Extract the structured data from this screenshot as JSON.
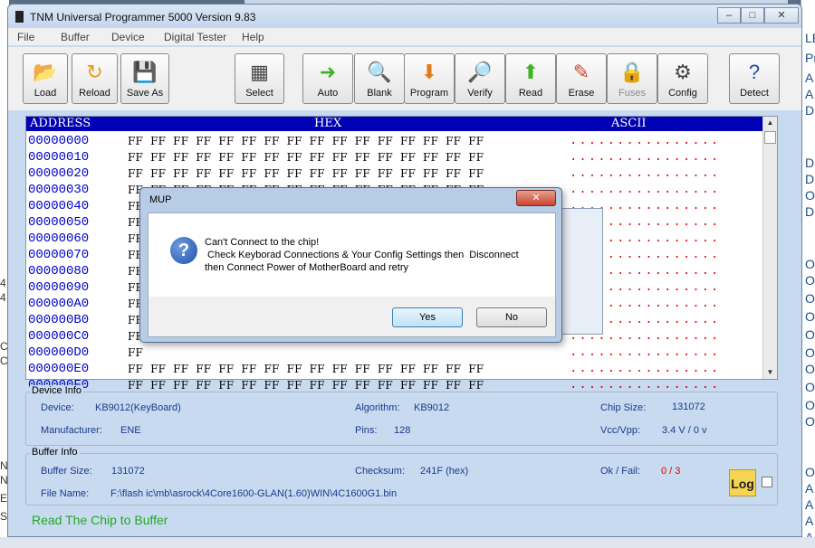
{
  "app": {
    "title": "TNM  Universal Programmer 5000  Version 9.83",
    "window_controls": [
      "–",
      "□",
      "✕"
    ]
  },
  "menu": [
    "File",
    "Buffer",
    "Device",
    "Digital Tester",
    "Help"
  ],
  "toolbar": [
    {
      "label": "Load",
      "icon": "folder-open-icon",
      "color": "#6abf3a",
      "glyph": "📂"
    },
    {
      "label": "Reload",
      "icon": "reload-folder-icon",
      "color": "#e89a1c",
      "glyph": "↻"
    },
    {
      "label": "Save As",
      "icon": "floppy-disk-icon",
      "color": "#333333",
      "glyph": "💾"
    },
    {
      "label": "Select",
      "icon": "chip-icon",
      "color": "#444444",
      "glyph": "▦"
    },
    {
      "label": "Auto",
      "icon": "green-arrow-icon",
      "color": "#3fb32a",
      "glyph": "➜"
    },
    {
      "label": "Blank",
      "icon": "magnifier-icon",
      "color": "#555555",
      "glyph": "🔍"
    },
    {
      "label": "Program",
      "icon": "download-arrow-icon",
      "color": "#e07a1a",
      "glyph": "⬇"
    },
    {
      "label": "Verify",
      "icon": "verify-magnifier-icon",
      "color": "#444444",
      "glyph": "🔎"
    },
    {
      "label": "Read",
      "icon": "read-arrow-icon",
      "color": "#3fb32a",
      "glyph": "⬆"
    },
    {
      "label": "Erase",
      "icon": "eraser-icon",
      "color": "#d2452e",
      "glyph": "✎"
    },
    {
      "label": "Fuses",
      "icon": "lock-icon",
      "color": "#d9b84a",
      "glyph": "🔒",
      "disabled": true
    },
    {
      "label": "Config",
      "icon": "tools-icon",
      "color": "#444444",
      "glyph": "⚙"
    },
    {
      "label": "Detect",
      "icon": "help-chip-icon",
      "color": "#1d4fa8",
      "glyph": "?"
    }
  ],
  "hex": {
    "headers": {
      "address": "ADDRESS",
      "hex": "HEX",
      "ascii": "ASCII"
    },
    "rows": [
      {
        "addr": "00000000",
        "bytes": "FF  FF  FF  FF  FF  FF  FF  FF  FF  FF  FF  FF  FF  FF  FF  FF",
        "ascii": "................"
      },
      {
        "addr": "00000010",
        "bytes": "FF  FF  FF  FF  FF  FF  FF  FF  FF  FF  FF  FF  FF  FF  FF  FF",
        "ascii": "................"
      },
      {
        "addr": "00000020",
        "bytes": "FF  FF  FF  FF  FF  FF  FF  FF  FF  FF  FF  FF  FF  FF  FF  FF",
        "ascii": "................"
      },
      {
        "addr": "00000030",
        "bytes": "FF  FF  FF  FF  FF  FF  FF  FF  FF  FF  FF  FF  FF  FF  FF  FF",
        "ascii": "................"
      },
      {
        "addr": "00000040",
        "bytes": "FF",
        "ascii": "................"
      },
      {
        "addr": "00000050",
        "bytes": "FF",
        "ascii": "................"
      },
      {
        "addr": "00000060",
        "bytes": "FF",
        "ascii": "................"
      },
      {
        "addr": "00000070",
        "bytes": "FF",
        "ascii": "................"
      },
      {
        "addr": "00000080",
        "bytes": "FF",
        "ascii": "................"
      },
      {
        "addr": "00000090",
        "bytes": "FF",
        "ascii": "................"
      },
      {
        "addr": "000000A0",
        "bytes": "FF",
        "ascii": "................"
      },
      {
        "addr": "000000B0",
        "bytes": "FF",
        "ascii": "................"
      },
      {
        "addr": "000000C0",
        "bytes": "FF",
        "ascii": "................"
      },
      {
        "addr": "000000D0",
        "bytes": "FF",
        "ascii": "................"
      },
      {
        "addr": "000000E0",
        "bytes": "FF  FF  FF  FF  FF  FF  FF  FF  FF  FF  FF  FF  FF  FF  FF  FF",
        "ascii": "................"
      },
      {
        "addr": "000000F0",
        "bytes": "FF  FF  FF  FF  FF  FF  FF  FF  FF  FF  FF  FF  FF  FF  FF  FF",
        "ascii": "................"
      }
    ]
  },
  "device_info": {
    "title": "Device Info",
    "device_label": "Device:",
    "device": "KB9012(KeyBoard)",
    "manufacturer_label": "Manufacturer:",
    "manufacturer": "ENE",
    "algorithm_label": "Algorithm:",
    "algorithm": "KB9012",
    "pins_label": "Pins:",
    "pins": "128",
    "chip_size_label": "Chip Size:",
    "chip_size": "131072",
    "vcc_label": "Vcc/Vpp:",
    "vcc": "3.4 V / 0 v"
  },
  "buffer_info": {
    "title": "Buffer Info",
    "size_label": "Buffer Size:",
    "size": "131072",
    "checksum_label": "Checksum:",
    "checksum": "241F (hex)",
    "okfail_label": "Ok / Fail:",
    "okfail": "0 / 3",
    "filename_label": "File Name:",
    "filename": "F:\\flash ic\\mb\\asrock\\4Core1600-GLAN(1.60)WIN\\4C1600G1.bin",
    "log_label": "Log"
  },
  "status": "Read The Chip to Buffer",
  "dialog": {
    "title": "MUP",
    "close": "✕",
    "line1": "Can't Connect to the chip!",
    "line2": " Check Keyborad Connections & Your Config Settings then  Disconnect",
    "line3": "then Connect Power of MotherBoard and retry",
    "yes": "Yes",
    "no": "No"
  },
  "colors": {
    "okfail": "#e00000",
    "status": "#22aa22",
    "address": "#0000c8",
    "ascii": "#e00000",
    "header_bg": "#0000b4"
  },
  "bg_right_chars": [
    "LE",
    "Pr",
    "A",
    "A",
    "D",
    "D",
    "D",
    "O",
    "D",
    "O",
    "O",
    "O",
    "O",
    "O",
    "O",
    "O",
    "O",
    "O",
    "O",
    "O",
    "A",
    "A",
    "A",
    "A"
  ],
  "bg_left_chars": [
    "4",
    "4",
    "C",
    "C",
    "N",
    "N",
    "E",
    "S"
  ]
}
